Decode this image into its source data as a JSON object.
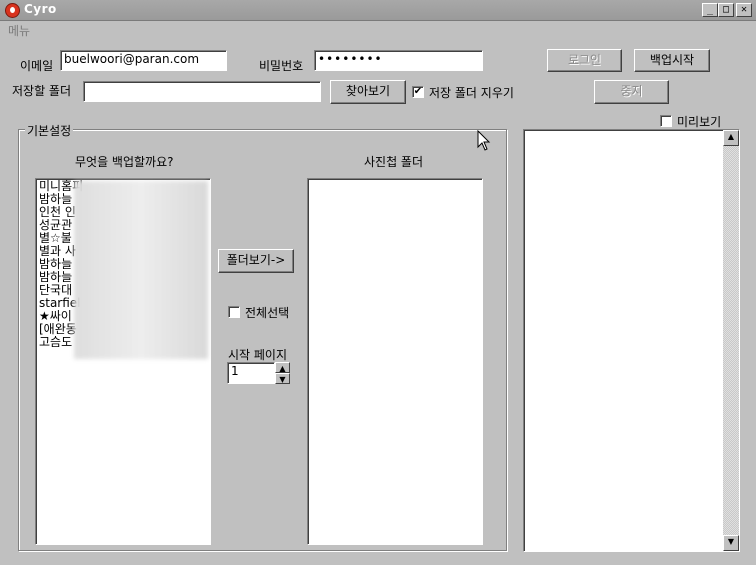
{
  "window": {
    "title": "Cyro"
  },
  "menu": {
    "items": [
      "메뉴"
    ]
  },
  "login": {
    "email_label": "이메일",
    "email_value": "buelwoori@paran.com",
    "password_label": "비밀번호",
    "password_value": "••••••••",
    "login_button": "로그인",
    "backup_start_button": "백업시작",
    "stop_button": "중지"
  },
  "save": {
    "folder_label": "저장할 폴더",
    "folder_value": "",
    "browse_button": "찾아보기",
    "clear_folder_label": "저장 폴더 지우기",
    "clear_folder_checked": true
  },
  "basic": {
    "group_title": "기본설정",
    "what_backup_label": "무엇을 백업할까요?",
    "backup_items": [
      "미니홈피",
      "밤하늘",
      "인천 인",
      "성균관",
      "별☆불",
      "별과 사",
      "밤하늘",
      "밤하늘",
      "단국대",
      "starfiel",
      "★싸이",
      "[애완동",
      "고슴도"
    ],
    "album_folder_label": "사진첩 폴더",
    "view_folder_button": "폴더보기->",
    "select_all_label": "전체선택",
    "select_all_checked": false,
    "start_page_label": "시작 페이지",
    "start_page_value": "1"
  },
  "preview": {
    "label": "미리보기",
    "checked": false
  }
}
